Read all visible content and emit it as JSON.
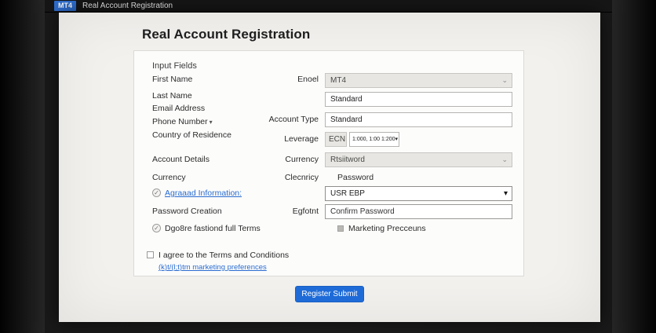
{
  "icons": {
    "check": "✓",
    "caret_down": "▾",
    "chevron_down": "⌄"
  },
  "colors": {
    "accent_blue": "#2e6fd2",
    "button_blue": "#1e6bd8",
    "link_blue": "#2a6cd0"
  },
  "titlebar": {
    "badge": "MT4",
    "title": "Real Account Registration"
  },
  "page": {
    "title": "Real Account Registration"
  },
  "form": {
    "section_title": "Input Fields",
    "left": {
      "first_name": "First Name",
      "last_name": "Last Name",
      "email_address": "Email Address",
      "phone_number": "Phone Number",
      "country_of_residence": "Country of Residence",
      "account_details": "Account Details",
      "currency": "Currency",
      "agreed_information": "Agraaad Information:",
      "password_creation": "Password Creation",
      "full_terms": "Dgo8re fastiond full Terms"
    },
    "mid": {
      "platform": "Enoel",
      "account_type": "Account Type",
      "leverage": "Leverage",
      "currency": "Currency",
      "currency2": "Clecnricy",
      "password": "Password",
      "confirm": "Egfotnt",
      "marketing": "Marketing Precceuns"
    },
    "values": {
      "platform": "MT4",
      "account_type": "Standard",
      "account_subtype": "Standard",
      "ecn": "ECN",
      "leverage": "1:000, 1:00 1:200",
      "currency": "Rtsiitword",
      "base_currency": "USR EBP",
      "confirm_password": "Confirm Password"
    },
    "agreement": {
      "terms": "I agree to the Terms and Conditions",
      "marketing_link": "(k)t/(l;t)tm marketing preferences"
    },
    "submit": "Register Submit"
  }
}
